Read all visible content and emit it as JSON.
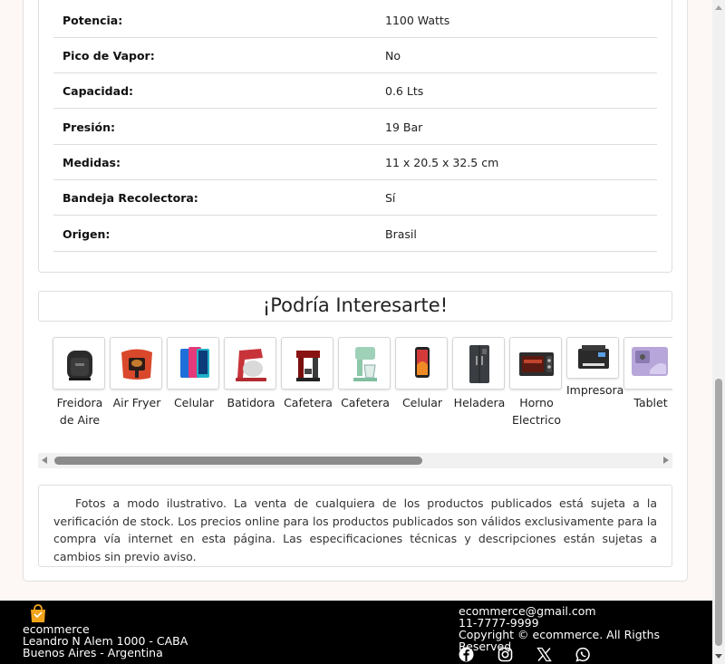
{
  "specs": [
    {
      "label": "Potencia:",
      "value": "1100 Watts"
    },
    {
      "label": "Pico de Vapor:",
      "value": "No"
    },
    {
      "label": "Capacidad:",
      "value": "0.6 Lts"
    },
    {
      "label": "Presión:",
      "value": "19 Bar"
    },
    {
      "label": "Medidas:",
      "value": "11 x 20.5 x 32.5 cm"
    },
    {
      "label": "Bandeja Recolectora:",
      "value": "Sí"
    },
    {
      "label": "Origen:",
      "value": "Brasil"
    }
  ],
  "related": {
    "title": "¡Podría Interesarte!",
    "products": [
      {
        "name": "Freidora de Aire",
        "icon": "air-fryer-icon"
      },
      {
        "name": "Air Fryer",
        "icon": "air-fryer-icon"
      },
      {
        "name": "Celular",
        "icon": "phone-icon"
      },
      {
        "name": "Batidora",
        "icon": "mixer-icon"
      },
      {
        "name": "Cafetera",
        "icon": "coffee-maker-icon"
      },
      {
        "name": "Cafetera",
        "icon": "coffee-maker-icon"
      },
      {
        "name": "Celular",
        "icon": "phone-icon"
      },
      {
        "name": "Heladera",
        "icon": "fridge-icon"
      },
      {
        "name": "Horno Electrico",
        "icon": "oven-icon"
      },
      {
        "name": "Impresora",
        "icon": "printer-icon"
      },
      {
        "name": "Tablet",
        "icon": "tablet-icon"
      }
    ]
  },
  "disclaimer": "Fotos a modo ilustrativo. La venta de cualquiera de los productos publicados está sujeta a la verificación de stock. Los precios online para los productos publicados son válidos exclusivamente para la compra vía internet en esta página. Las especificaciones técnicas y descripciones están sujetas a cambios sin previo aviso.",
  "footer": {
    "brand": "ecommerce",
    "address1": "Leandro N Alem 1000 - CABA",
    "address2": "Buenos Aires - Argentina",
    "email": "ecommerce@gmail.com",
    "phone": "11-7777-9999",
    "copyright": "Copyright © ecommerce. All Rigths Reserved",
    "social_icons": [
      "facebook-icon",
      "instagram-icon",
      "x-icon",
      "whatsapp-icon"
    ]
  },
  "colors": {
    "footer_bg": "#000000",
    "page_bg": "#fdf7f6",
    "logo_orange": "#f2a51a"
  }
}
